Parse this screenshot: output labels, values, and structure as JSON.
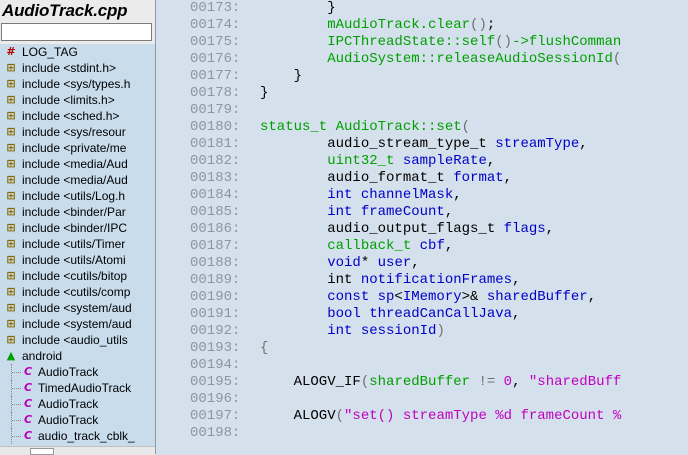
{
  "panel": {
    "title": "AudioTrack.cpp",
    "search_value": "",
    "symbols": [
      {
        "icon": "hash-icon",
        "glyph": "#",
        "label": "LOG_TAG",
        "child": false
      },
      {
        "icon": "include-icon",
        "glyph": "⊞",
        "label": "include <stdint.h>",
        "child": false
      },
      {
        "icon": "include-icon",
        "glyph": "⊞",
        "label": "include <sys/types.h",
        "child": false
      },
      {
        "icon": "include-icon",
        "glyph": "⊞",
        "label": "include <limits.h>",
        "child": false
      },
      {
        "icon": "include-icon",
        "glyph": "⊞",
        "label": "include <sched.h>",
        "child": false
      },
      {
        "icon": "include-icon",
        "glyph": "⊞",
        "label": "include <sys/resour",
        "child": false
      },
      {
        "icon": "include-icon",
        "glyph": "⊞",
        "label": "include <private/me",
        "child": false
      },
      {
        "icon": "include-icon",
        "glyph": "⊞",
        "label": "include <media/Aud",
        "child": false
      },
      {
        "icon": "include-icon",
        "glyph": "⊞",
        "label": "include <media/Aud",
        "child": false
      },
      {
        "icon": "include-icon",
        "glyph": "⊞",
        "label": "include <utils/Log.h",
        "child": false
      },
      {
        "icon": "include-icon",
        "glyph": "⊞",
        "label": "include <binder/Par",
        "child": false
      },
      {
        "icon": "include-icon",
        "glyph": "⊞",
        "label": "include <binder/IPC",
        "child": false
      },
      {
        "icon": "include-icon",
        "glyph": "⊞",
        "label": "include <utils/Timer",
        "child": false
      },
      {
        "icon": "include-icon",
        "glyph": "⊞",
        "label": "include <utils/Atomi",
        "child": false
      },
      {
        "icon": "include-icon",
        "glyph": "⊞",
        "label": "include <cutils/bitop",
        "child": false
      },
      {
        "icon": "include-icon",
        "glyph": "⊞",
        "label": "include <cutils/comp",
        "child": false
      },
      {
        "icon": "include-icon",
        "glyph": "⊞",
        "label": "include <system/aud",
        "child": false
      },
      {
        "icon": "include-icon",
        "glyph": "⊞",
        "label": "include <system/aud",
        "child": false
      },
      {
        "icon": "include-icon",
        "glyph": "⊞",
        "label": "include <audio_utils",
        "child": false
      },
      {
        "icon": "namespace-icon",
        "glyph": "▲",
        "label": "android",
        "child": false
      },
      {
        "icon": "class-icon",
        "glyph": "C",
        "label": "AudioTrack",
        "child": true
      },
      {
        "icon": "class-icon",
        "glyph": "C",
        "label": "TimedAudioTrack",
        "child": true
      },
      {
        "icon": "class-icon",
        "glyph": "C",
        "label": "AudioTrack",
        "child": true
      },
      {
        "icon": "class-icon",
        "glyph": "C",
        "label": "AudioTrack",
        "child": true
      },
      {
        "icon": "class-icon",
        "glyph": "C",
        "label": "audio_track_cblk_",
        "child": true
      }
    ]
  },
  "editor": {
    "lines": [
      {
        "num": "00173:",
        "tokens": [
          [
            "p",
            "        }"
          ]
        ]
      },
      {
        "num": "00174:",
        "tokens": [
          [
            "g",
            "        mAudioTrack.clear"
          ],
          [
            "o",
            "()"
          ],
          [
            "p",
            ";"
          ]
        ]
      },
      {
        "num": "00175:",
        "tokens": [
          [
            "g",
            "        IPCThreadState::self"
          ],
          [
            "o",
            "()"
          ],
          [
            "g",
            "->flushComman"
          ]
        ]
      },
      {
        "num": "00176:",
        "tokens": [
          [
            "g",
            "        AudioSystem::releaseAudioSessionId"
          ],
          [
            "o",
            "("
          ]
        ]
      },
      {
        "num": "00177:",
        "tokens": [
          [
            "p",
            "    }"
          ]
        ]
      },
      {
        "num": "00178:",
        "tokens": [
          [
            "p",
            "}"
          ]
        ]
      },
      {
        "num": "00179:",
        "tokens": [
          [
            "p",
            ""
          ]
        ]
      },
      {
        "num": "00180:",
        "tokens": [
          [
            "g",
            "status_t AudioTrack::set"
          ],
          [
            "o",
            "("
          ]
        ]
      },
      {
        "num": "00181:",
        "tokens": [
          [
            "k",
            "        audio_stream_type_t "
          ],
          [
            "b",
            "streamType"
          ],
          [
            "p",
            ","
          ]
        ]
      },
      {
        "num": "00182:",
        "tokens": [
          [
            "g",
            "        uint32_t "
          ],
          [
            "b",
            "sampleRate"
          ],
          [
            "p",
            ","
          ]
        ]
      },
      {
        "num": "00183:",
        "tokens": [
          [
            "k",
            "        audio_format_t "
          ],
          [
            "b",
            "format"
          ],
          [
            "p",
            ","
          ]
        ]
      },
      {
        "num": "00184:",
        "tokens": [
          [
            "b",
            "        int channelMask"
          ],
          [
            "p",
            ","
          ]
        ]
      },
      {
        "num": "00185:",
        "tokens": [
          [
            "b",
            "        int frameCount"
          ],
          [
            "p",
            ","
          ]
        ]
      },
      {
        "num": "00186:",
        "tokens": [
          [
            "k",
            "        audio_output_flags_t "
          ],
          [
            "b",
            "flags"
          ],
          [
            "p",
            ","
          ]
        ]
      },
      {
        "num": "00187:",
        "tokens": [
          [
            "g",
            "        callback_t "
          ],
          [
            "b",
            "cbf"
          ],
          [
            "p",
            ","
          ]
        ]
      },
      {
        "num": "00188:",
        "tokens": [
          [
            "b",
            "        void"
          ],
          [
            "p",
            "* "
          ],
          [
            "b",
            "user"
          ],
          [
            "p",
            ","
          ]
        ]
      },
      {
        "num": "00189:",
        "tokens": [
          [
            "k",
            "        int "
          ],
          [
            "b",
            "notificationFrames"
          ],
          [
            "p",
            ","
          ]
        ]
      },
      {
        "num": "00190:",
        "tokens": [
          [
            "b",
            "        const sp"
          ],
          [
            "p",
            "<"
          ],
          [
            "b",
            "IMemory"
          ],
          [
            "p",
            ">& "
          ],
          [
            "b",
            "sharedBuffer"
          ],
          [
            "p",
            ","
          ]
        ]
      },
      {
        "num": "00191:",
        "tokens": [
          [
            "b",
            "        bool threadCanCallJava"
          ],
          [
            "p",
            ","
          ]
        ]
      },
      {
        "num": "00192:",
        "tokens": [
          [
            "b",
            "        int sessionId"
          ],
          [
            "o",
            ")"
          ]
        ]
      },
      {
        "num": "00193:",
        "tokens": [
          [
            "o",
            "{"
          ]
        ]
      },
      {
        "num": "00194:",
        "tokens": [
          [
            "p",
            ""
          ]
        ]
      },
      {
        "num": "00195:",
        "tokens": [
          [
            "k",
            "    ALOGV_IF"
          ],
          [
            "o",
            "("
          ],
          [
            "g",
            "sharedBuffer "
          ],
          [
            "o",
            "!= "
          ],
          [
            "m",
            "0"
          ],
          [
            "p",
            ", "
          ],
          [
            "m",
            "\"sharedBuff"
          ]
        ]
      },
      {
        "num": "00196:",
        "tokens": [
          [
            "p",
            ""
          ]
        ]
      },
      {
        "num": "00197:",
        "tokens": [
          [
            "k",
            "    ALOGV"
          ],
          [
            "o",
            "("
          ],
          [
            "m",
            "\"set() streamType %d frameCount %"
          ]
        ]
      },
      {
        "num": "00198:",
        "tokens": [
          [
            "p",
            ""
          ]
        ]
      }
    ]
  }
}
